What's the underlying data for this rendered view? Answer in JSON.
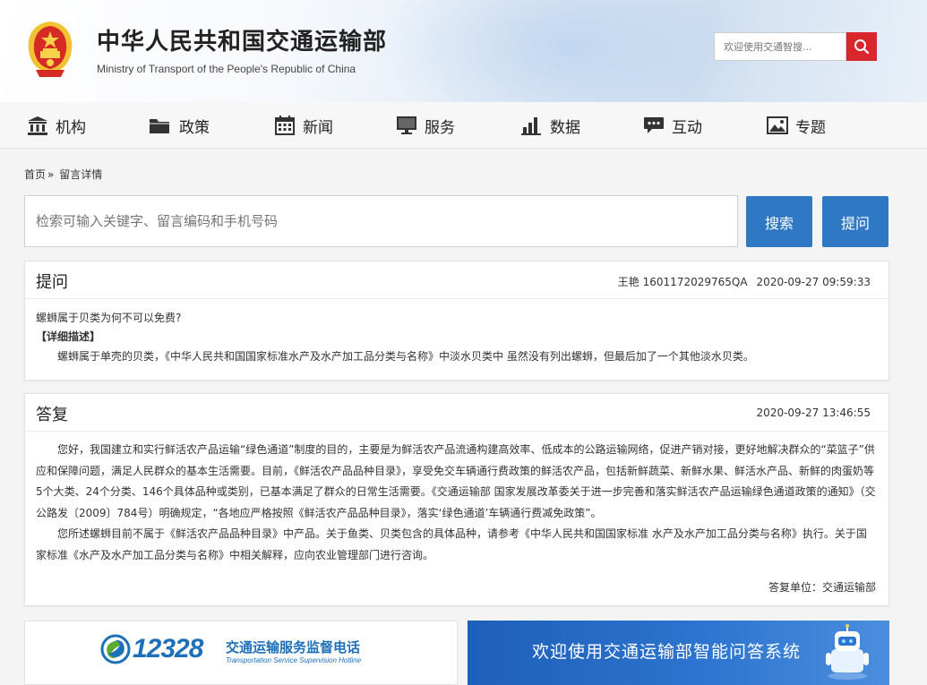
{
  "header": {
    "title_cn": "中华人民共和国交通运输部",
    "title_en": "Ministry of Transport of the People's Republic of China",
    "search_placeholder": "欢迎使用交通智搜..."
  },
  "nav": [
    {
      "label": "机构",
      "icon": "institution-icon"
    },
    {
      "label": "政策",
      "icon": "folder-icon"
    },
    {
      "label": "新闻",
      "icon": "calendar-icon"
    },
    {
      "label": "服务",
      "icon": "monitor-icon"
    },
    {
      "label": "数据",
      "icon": "bar-chart-icon"
    },
    {
      "label": "互动",
      "icon": "chat-bubble-icon"
    },
    {
      "label": "专题",
      "icon": "image-icon"
    }
  ],
  "breadcrumb": {
    "home": "首页",
    "separator": "»",
    "current": "留言详情"
  },
  "search": {
    "placeholder": "检索可输入关键字、留言编码和手机号码",
    "search_label": "搜索",
    "ask_label": "提问"
  },
  "question": {
    "title": "提问",
    "author": "王艳",
    "code": "1601172029765QA",
    "time": "2020-09-27 09:59:33",
    "subject": "螺蛳属于贝类为何不可以免费?",
    "detail_label": "【详细描述】",
    "detail": "螺蛳属于单壳的贝类，《中华人民共和国国家标准水产及水产加工品分类与名称》中淡水贝类中 虽然没有列出螺蛳，但最后加了一个其他淡水贝类。"
  },
  "answer": {
    "title": "答复",
    "time": "2020-09-27 13:46:55",
    "para1": "您好，我国建立和实行鲜活农产品运输“绿色通道”制度的目的，主要是为鲜活农产品流通构建高效率、低成本的公路运输网络，促进产销对接，更好地解决群众的“菜篮子”供应和保障问题，满足人民群众的基本生活需要。目前，《鲜活农产品品种目录》，享受免交车辆通行费政策的鲜活农产品，包括新鲜蔬菜、新鲜水果、鲜活水产品、新鲜的肉蛋奶等5个大类、24个分类、146个具体品种或类别，已基本满足了群众的日常生活需要。《交通运输部 国家发展改革委关于进一步完善和落实鲜活农产品运输绿色通道政策的通知》（交公路发〔2009〕784号）明确规定，“各地应严格按照《鲜活农产品品种目录》，落实‘绿色通道’车辆通行费减免政策”。",
    "para2": "您所述螺蛳目前不属于《鲜活农产品品种目录》中产品。关于鱼类、贝类包含的具体品种，请参考《中华人民共和国国家标准 水产及水产加工品分类与名称》执行。关于国家标准《水产及水产加工品分类与名称》中相关解释，应向农业管理部门进行咨询。",
    "unit_label": "答复单位：",
    "unit": "交通运输部"
  },
  "banners": {
    "hotline_number": "12328",
    "hotline_cn": "交通运输服务监督电话",
    "hotline_en": "Transportation Service Supervision Hotline",
    "qa_system": "欢迎使用交通运输部智能问答系统"
  },
  "colors": {
    "accent_red": "#d9262c",
    "accent_blue": "#2f78c4",
    "hotline_blue": "#1d6fb8",
    "hotline_green": "#5bab2e"
  }
}
